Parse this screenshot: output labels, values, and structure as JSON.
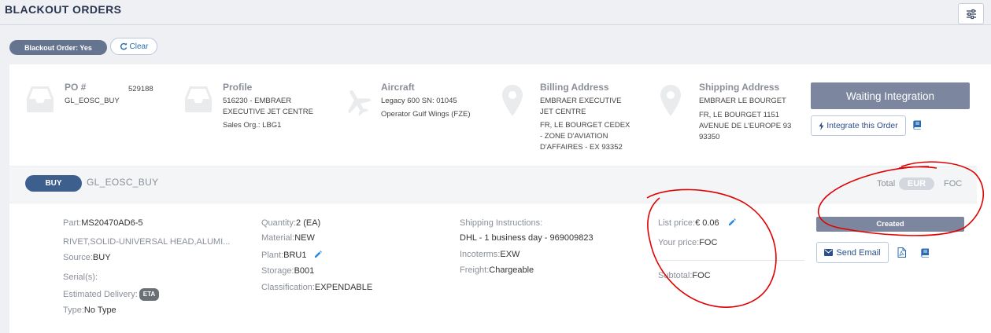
{
  "page": {
    "title": "BLACKOUT ORDERS"
  },
  "filters": {
    "active_chip": "Blackout Order: Yes",
    "clear_label": "Clear"
  },
  "order_header": {
    "po": {
      "title": "PO #",
      "number": "529188",
      "code": "GL_EOSC_BUY"
    },
    "profile": {
      "title": "Profile",
      "lines": [
        "516230 - EMBRAER",
        "EXECUTIVE JET CENTRE",
        "Sales Org.: LBG1"
      ]
    },
    "aircraft": {
      "title": "Aircraft",
      "lines": [
        "Legacy 600 SN: 01045",
        "Operator Gulf Wings (FZE)"
      ]
    },
    "billing": {
      "title": "Billing Address",
      "lines": [
        "EMBRAER EXECUTIVE",
        "JET CENTRE",
        "FR, LE BOURGET CEDEX",
        "- ZONE D'AVIATION",
        "D'AFFAIRES - EX 93352"
      ]
    },
    "shipping": {
      "title": "Shipping Address",
      "lines": [
        "EMBRAER LE BOURGET",
        "FR, LE BOURGET 1151",
        "AVENUE DE L'EUROPE 93",
        "93350"
      ]
    },
    "status_button": "Waiting Integration",
    "integrate_label": "Integrate this Order"
  },
  "section": {
    "type_pill": "BUY",
    "order_code": "GL_EOSC_BUY",
    "total_label": "Total",
    "currency_selected": "EUR",
    "total_value": "FOC"
  },
  "line_item": {
    "part": {
      "label": "Part:",
      "value": "MS20470AD6-5"
    },
    "description": "RIVET,SOLID-UNIVERSAL HEAD,ALUMI...",
    "source": {
      "label": "Source:",
      "value": "BUY"
    },
    "serials": {
      "label": "Serial(s):"
    },
    "estimated_delivery": {
      "label": "Estimated Delivery:",
      "badge": "ETA"
    },
    "type": {
      "label": "Type:",
      "value": "No Type"
    },
    "quantity": {
      "label": "Quantity:",
      "value": "2 (EA)"
    },
    "material": {
      "label": "Material:",
      "value": "NEW"
    },
    "plant": {
      "label": "Plant:",
      "value": "BRU1"
    },
    "storage": {
      "label": "Storage:",
      "value": "B001"
    },
    "classification": {
      "label": "Classification:",
      "value": "EXPENDABLE"
    },
    "shipping_instructions": {
      "label": "Shipping Instructions:",
      "value": "DHL - 1 business day - 969009823"
    },
    "incoterms": {
      "label": "Incoterms:",
      "value": "EXW"
    },
    "freight": {
      "label": "Freight:",
      "value": "Chargeable"
    },
    "list_price": {
      "label": "List price:",
      "value": "€ 0.06"
    },
    "your_price": {
      "label": "Your price:",
      "value": "FOC"
    },
    "subtotal": {
      "label": "Subtotal:",
      "value": "FOC"
    },
    "status_badge": "Created",
    "send_email_label": "Send Email"
  },
  "colors": {
    "accent": "#2b6cb0",
    "status_gray": "#7c879f",
    "pill_blue": "#3d5f8e",
    "annotation_red": "#e00000"
  },
  "icons": [
    "settings-sliders-icon",
    "refresh-icon",
    "inbox-tray-icon",
    "airplane-icon",
    "map-pin-icon",
    "bolt-icon",
    "book-icon",
    "pencil-icon",
    "envelope-icon",
    "pdf-file-icon"
  ]
}
